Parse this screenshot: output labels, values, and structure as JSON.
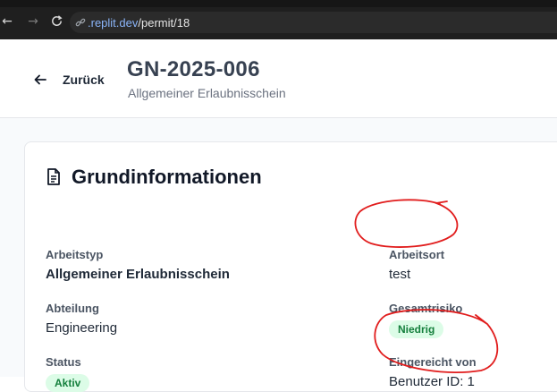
{
  "browser": {
    "url_host": ".replit.dev",
    "url_path": "/permit/18"
  },
  "header": {
    "back_label": "Zurück",
    "permit_number": "GN-2025-006",
    "permit_type": "Allgemeiner Erlaubnisschein"
  },
  "card": {
    "title": "Grundinformationen",
    "fields": {
      "arbeitstyp": {
        "label": "Arbeitstyp",
        "value": "Allgemeiner Erlaubnisschein"
      },
      "arbeitsort": {
        "label": "Arbeitsort",
        "value": "test"
      },
      "abteilung": {
        "label": "Abteilung",
        "value": "Engineering"
      },
      "gesamtrisiko": {
        "label": "Gesamtrisiko",
        "value": "Niedrig"
      },
      "status": {
        "label": "Status",
        "value": "Aktiv"
      },
      "eingereicht_von": {
        "label": "Eingereicht von",
        "value": "Benutzer ID: 1"
      }
    }
  },
  "colors": {
    "annotation_red": "#e11d1d",
    "badge_green_bg": "#dcfce7",
    "badge_green_text": "#15803d"
  },
  "icons": [
    "arrow-left-icon",
    "arrow-right-icon",
    "reload-icon",
    "link-icon",
    "document-icon"
  ]
}
